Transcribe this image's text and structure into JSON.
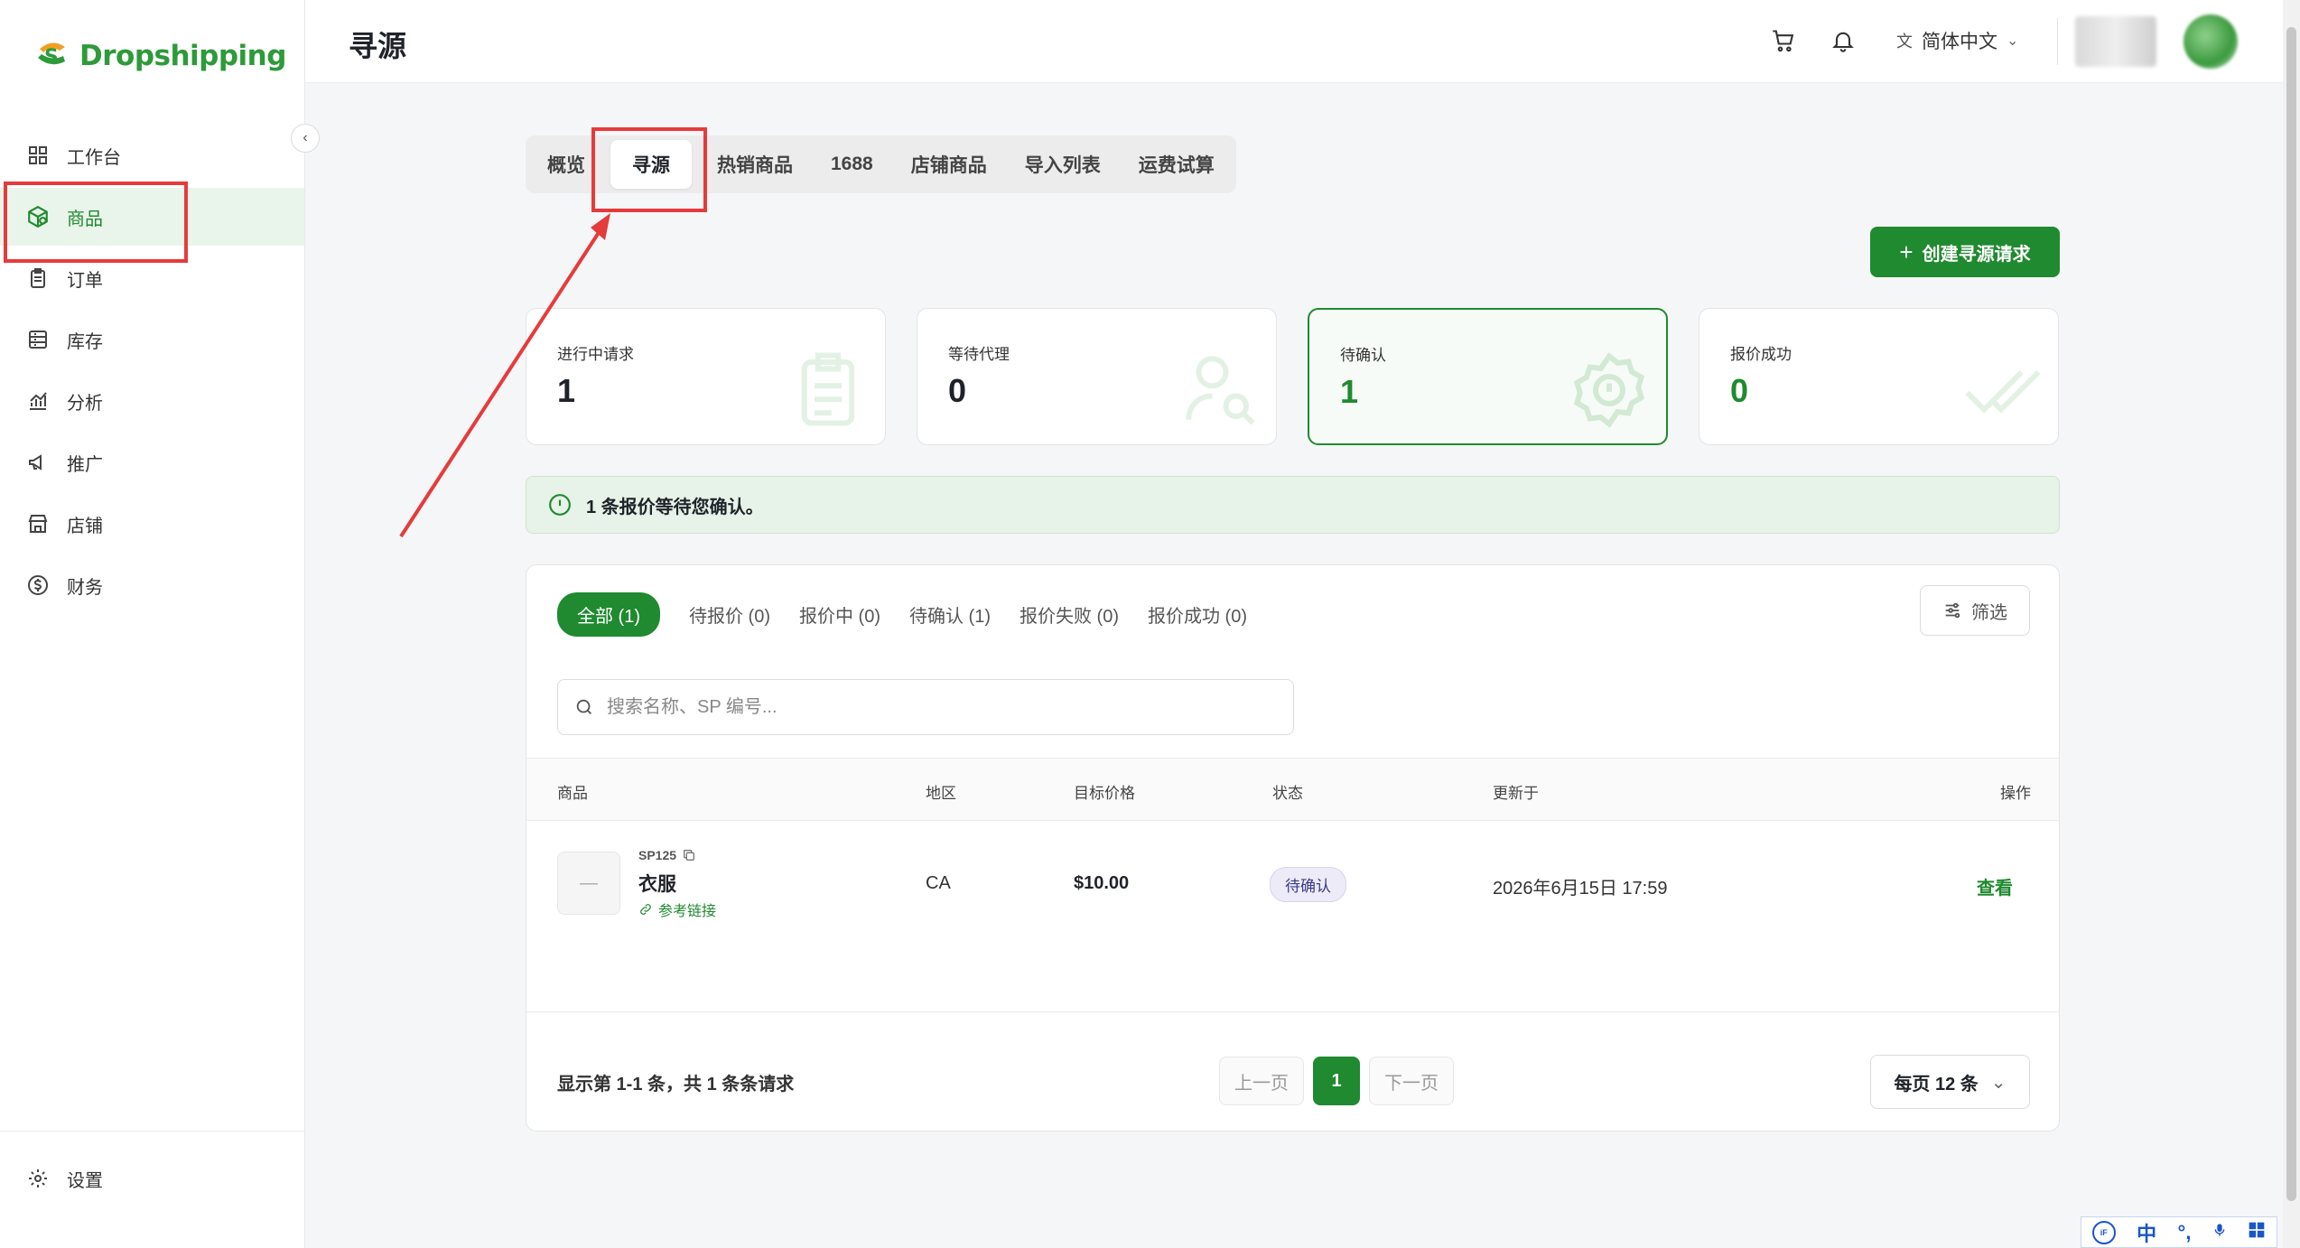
{
  "app": {
    "brand": "Dropshipping",
    "brand_color": "#2e9a3a",
    "accent": "#1f8a2f"
  },
  "sidebar": {
    "items": [
      {
        "label": "工作台",
        "icon": "dashboard-icon",
        "active": false
      },
      {
        "label": "商品",
        "icon": "product-box-icon",
        "active": true
      },
      {
        "label": "订单",
        "icon": "order-clipboard-icon",
        "active": false
      },
      {
        "label": "库存",
        "icon": "inventory-icon",
        "active": false
      },
      {
        "label": "分析",
        "icon": "analytics-chart-icon",
        "active": false
      },
      {
        "label": "推广",
        "icon": "megaphone-icon",
        "active": false
      },
      {
        "label": "店铺",
        "icon": "store-icon",
        "active": false
      },
      {
        "label": "财务",
        "icon": "dollar-circle-icon",
        "active": false
      }
    ],
    "settings": {
      "label": "设置",
      "icon": "gear-icon"
    }
  },
  "header": {
    "title": "寻源",
    "language": "简体中文"
  },
  "tabs": [
    {
      "label": "概览",
      "active": false
    },
    {
      "label": "寻源",
      "active": true
    },
    {
      "label": "热销商品",
      "active": false
    },
    {
      "label": "1688",
      "active": false
    },
    {
      "label": "店铺商品",
      "active": false
    },
    {
      "label": "导入列表",
      "active": false
    },
    {
      "label": "运费试算",
      "active": false
    }
  ],
  "create_button": {
    "label": "创建寻源请求"
  },
  "stats": [
    {
      "label": "进行中请求",
      "value": "1",
      "highlight": false
    },
    {
      "label": "等待代理",
      "value": "0",
      "highlight": false
    },
    {
      "label": "待确认",
      "value": "1",
      "highlight": true
    },
    {
      "label": "报价成功",
      "value": "0",
      "highlight": false
    }
  ],
  "notice": {
    "text": "1 条报价等待您确认。"
  },
  "filters": [
    {
      "label": "全部 (1)",
      "active": true
    },
    {
      "label": "待报价 (0)",
      "active": false
    },
    {
      "label": "报价中 (0)",
      "active": false
    },
    {
      "label": "待确认 (1)",
      "active": false
    },
    {
      "label": "报价失败 (0)",
      "active": false
    },
    {
      "label": "报价成功 (0)",
      "active": false
    }
  ],
  "filter_button": {
    "label": "筛选"
  },
  "search": {
    "placeholder": "搜索名称、SP 编号..."
  },
  "table": {
    "columns": [
      "商品",
      "地区",
      "目标价格",
      "状态",
      "更新于",
      "操作"
    ],
    "rows": [
      {
        "sp_code": "SP125",
        "thumb": "—",
        "name": "衣服",
        "ref_link": "参考链接",
        "region": "CA",
        "target_price": "$10.00",
        "status": "待确认",
        "updated": "2026年6月15日 17:59",
        "action": "查看"
      }
    ]
  },
  "pagination": {
    "summary": "显示第 1-1 条，共 1 条条请求",
    "prev": "上一页",
    "current": "1",
    "next": "下一页",
    "per_page": "每页 12 条"
  },
  "ime": {
    "mode": "中"
  }
}
